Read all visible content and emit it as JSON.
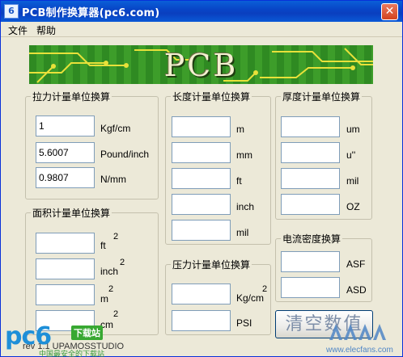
{
  "window": {
    "title": "PCB制作换算器(pc6.com)",
    "icon_text": "6",
    "close_label": "✕"
  },
  "menu": {
    "items": [
      "文件",
      "帮助"
    ]
  },
  "banner": {
    "title": "PCB"
  },
  "groups": {
    "tension": {
      "title": "拉力计量单位换算",
      "fields": [
        {
          "value": "1",
          "unit": "Kgf/cm"
        },
        {
          "value": "5.6007",
          "unit": "Pound/inch"
        },
        {
          "value": "0.9807",
          "unit": "N/mm"
        }
      ]
    },
    "area": {
      "title": "面积计量单位换算",
      "fields": [
        {
          "value": "",
          "unit": "ft",
          "sup": "2"
        },
        {
          "value": "",
          "unit": "inch",
          "sup": "2"
        },
        {
          "value": "",
          "unit": "m",
          "sup": "2"
        },
        {
          "value": "",
          "unit": "cm",
          "sup": "2"
        }
      ]
    },
    "length": {
      "title": "长度计量单位换算",
      "fields": [
        {
          "value": "",
          "unit": "m"
        },
        {
          "value": "",
          "unit": "mm"
        },
        {
          "value": "",
          "unit": "ft"
        },
        {
          "value": "",
          "unit": "inch"
        },
        {
          "value": "",
          "unit": "mil"
        }
      ]
    },
    "pressure": {
      "title": "压力计量单位换算",
      "fields": [
        {
          "value": "",
          "unit": "Kg/cm",
          "sup": "2"
        },
        {
          "value": "",
          "unit": "PSI"
        }
      ]
    },
    "thickness": {
      "title": "厚度计量单位换算",
      "fields": [
        {
          "value": "",
          "unit": "um"
        },
        {
          "value": "",
          "unit": "u''"
        },
        {
          "value": "",
          "unit": "mil"
        },
        {
          "value": "",
          "unit": "OZ"
        }
      ]
    },
    "current": {
      "title": "电流密度换算",
      "fields": [
        {
          "value": "",
          "unit": "ASF"
        },
        {
          "value": "",
          "unit": "ASD"
        }
      ]
    }
  },
  "actions": {
    "clear_label": "清空数值"
  },
  "footer": {
    "version": "rev 1.1 UPAMOSSTUDIO"
  },
  "watermarks": {
    "left_logo": "pc6",
    "left_badge": "下载站",
    "left_sub": "中国最安全的下载站",
    "right_text": "www.elecfans.com"
  }
}
